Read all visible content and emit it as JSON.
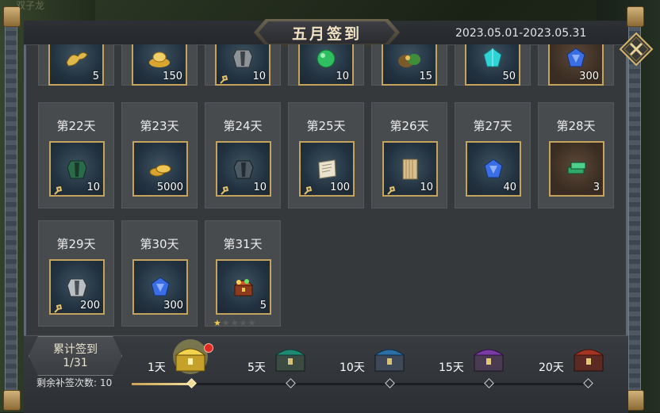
{
  "background_text": "双子龙",
  "header": {
    "title": "五月签到",
    "date_range": "2023.05.01-2023.05.31"
  },
  "colors": {
    "frame_gold": "#c4a35e",
    "panel": "#36393c",
    "card": "#484b4e",
    "progress_fill": "#f3dc9a",
    "notification_dot": "#e02a22"
  },
  "partial_row": [
    {
      "item_icon": "golden-dragon-icon",
      "qty": "5",
      "bound": false
    },
    {
      "item_icon": "gold-ingot-icon",
      "qty": "150",
      "bound": false
    },
    {
      "item_icon": "armor-icon",
      "qty": "10",
      "bound": true
    },
    {
      "item_icon": "jade-orb-icon",
      "qty": "10",
      "bound": false
    },
    {
      "item_icon": "treasure-pouch-icon",
      "qty": "15",
      "bound": false
    },
    {
      "item_icon": "cyan-gem-icon",
      "qty": "50",
      "bound": false
    },
    {
      "item_icon": "blue-gem-icon",
      "qty": "300",
      "bound": false
    }
  ],
  "days": [
    {
      "label": "第22天",
      "item_icon": "green-armor-icon",
      "qty": "10",
      "bound": true
    },
    {
      "label": "第23天",
      "item_icon": "gold-coins-icon",
      "qty": "5000",
      "bound": false
    },
    {
      "label": "第24天",
      "item_icon": "dark-armor-icon",
      "qty": "10",
      "bound": true
    },
    {
      "label": "第25天",
      "item_icon": "scroll-icon",
      "qty": "100",
      "bound": true
    },
    {
      "label": "第26天",
      "item_icon": "bamboo-slip-icon",
      "qty": "10",
      "bound": true
    },
    {
      "label": "第27天",
      "item_icon": "blue-gem-icon",
      "qty": "40",
      "bound": false
    },
    {
      "label": "第28天",
      "item_icon": "jade-bars-icon",
      "qty": "3",
      "bound": false
    },
    {
      "label": "第29天",
      "item_icon": "silver-armor-icon",
      "qty": "200",
      "bound": true
    },
    {
      "label": "第30天",
      "item_icon": "blue-gem-icon",
      "qty": "300",
      "bound": false
    },
    {
      "label": "第31天",
      "item_icon": "treasure-chest-icon",
      "qty": "5",
      "bound": false,
      "rating": 1,
      "rating_max": 5
    }
  ],
  "cumulative": {
    "label": "累计签到",
    "value": "1/31",
    "progress_fraction": 0.13
  },
  "makeup": {
    "label": "剩余补签次数:",
    "value": "10"
  },
  "milestones": [
    {
      "label": "1天",
      "chest_icon": "golden-glowing-chest-icon",
      "reached": true,
      "has_notification": true
    },
    {
      "label": "5天",
      "chest_icon": "teal-chest-icon",
      "reached": false,
      "has_notification": false
    },
    {
      "label": "10天",
      "chest_icon": "blue-chest-icon",
      "reached": false,
      "has_notification": false
    },
    {
      "label": "15天",
      "chest_icon": "purple-chest-icon",
      "reached": false,
      "has_notification": false
    },
    {
      "label": "20天",
      "chest_icon": "red-chest-icon",
      "reached": false,
      "has_notification": false
    }
  ]
}
